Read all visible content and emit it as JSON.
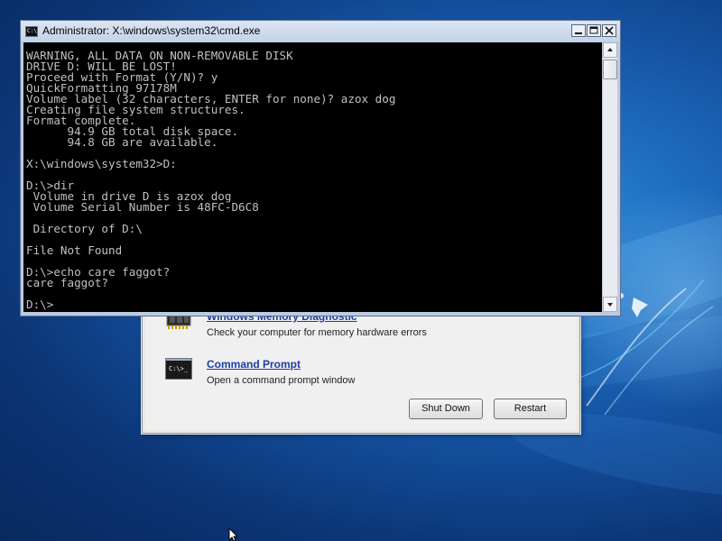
{
  "cmd_window": {
    "title": "Administrator: X:\\windows\\system32\\cmd.exe",
    "icon": "cmd-icon",
    "console_text": "WARNING, ALL DATA ON NON-REMOVABLE DISK\nDRIVE D: WILL BE LOST!\nProceed with Format (Y/N)? y\nQuickFormatting 97178M\nVolume label (32 characters, ENTER for none)? azox dog\nCreating file system structures.\nFormat complete.\n      94.9 GB total disk space.\n      94.8 GB are available.\n\nX:\\windows\\system32>D:\n\nD:\\>dir\n Volume in drive D is azox dog\n Volume Serial Number is 48FC-D6C8\n\n Directory of D:\\\n\nFile Not Found\n\nD:\\>echo care faggot?\ncare faggot?\n\nD:\\>",
    "buttons": [
      "minimize",
      "maximize",
      "close"
    ]
  },
  "recovery_dialog": {
    "tools": [
      {
        "title": "Windows Memory Diagnostic",
        "description": "Check your computer for memory hardware errors",
        "icon": "memory-chip-icon"
      },
      {
        "title": "Command Prompt",
        "description": "Open a command prompt window",
        "icon": "command-prompt-icon",
        "icon_text": "C:\\>_"
      }
    ],
    "shutdown_label": "Shut Down",
    "restart_label": "Restart"
  },
  "colors": {
    "console_background": "#000000",
    "console_text": "#c0c0c0",
    "link": "#1b3fa6",
    "desktop": "#14509e"
  }
}
